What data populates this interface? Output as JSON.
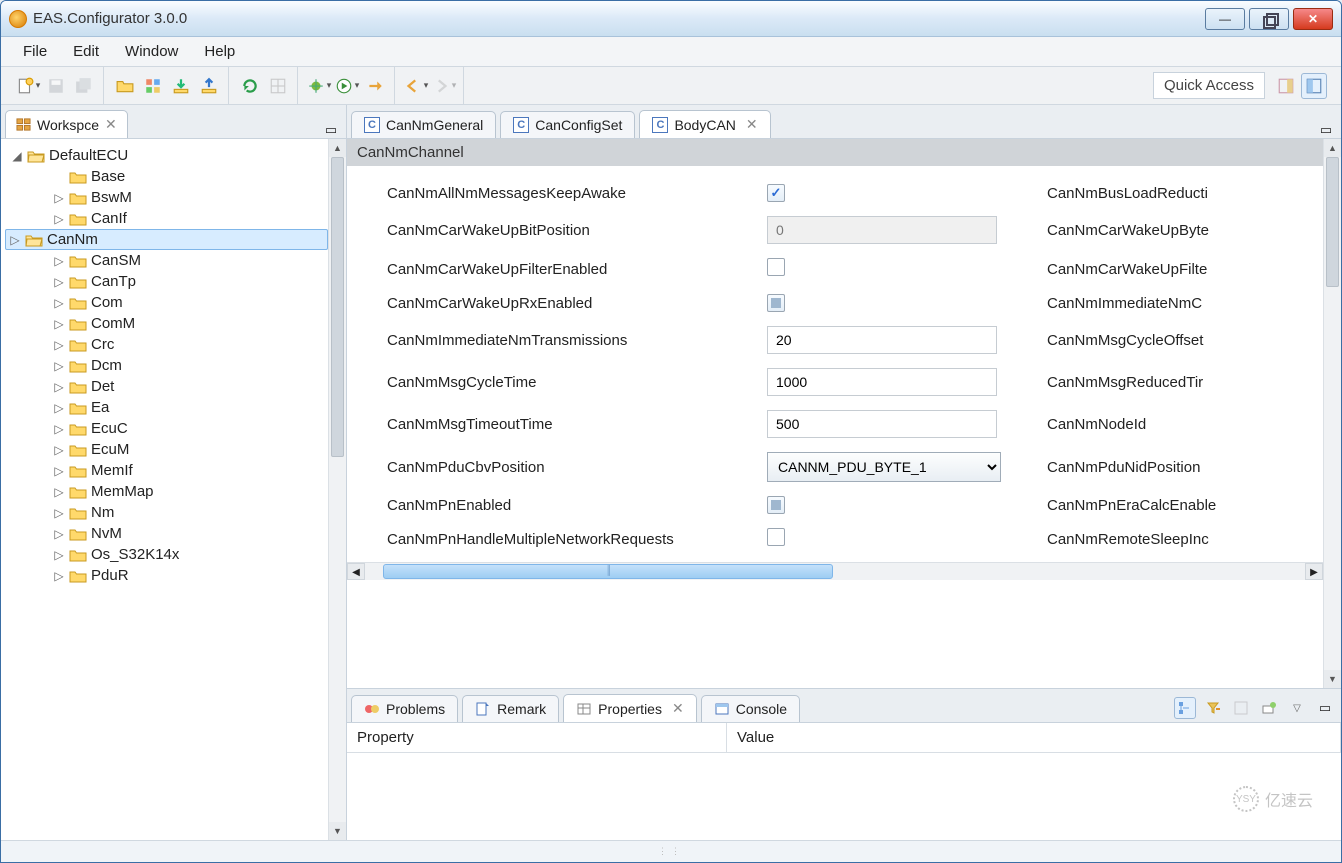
{
  "window": {
    "title": "EAS.Configurator 3.0.0",
    "quick_access": "Quick Access"
  },
  "menu": {
    "file": "File",
    "edit": "Edit",
    "window": "Window",
    "help": "Help"
  },
  "workspace": {
    "tab_label": "Workspce",
    "root": "DefaultECU",
    "items": [
      "Base",
      "BswM",
      "CanIf",
      "CanNm",
      "CanSM",
      "CanTp",
      "Com",
      "ComM",
      "Crc",
      "Dcm",
      "Det",
      "Ea",
      "EcuC",
      "EcuM",
      "MemIf",
      "MemMap",
      "Nm",
      "NvM",
      "Os_S32K14x",
      "PduR"
    ],
    "selected": "CanNm"
  },
  "editor": {
    "tabs": [
      {
        "label": "CanNmGeneral",
        "active": false
      },
      {
        "label": "CanConfigSet",
        "active": false
      },
      {
        "label": "BodyCAN",
        "active": true
      }
    ],
    "section": "CanNmChannel",
    "fields": [
      {
        "label": "CanNmAllNmMessagesKeepAwake",
        "type": "check",
        "state": "checked",
        "right": "CanNmBusLoadReducti"
      },
      {
        "label": "CanNmCarWakeUpBitPosition",
        "type": "text",
        "value": "0",
        "disabled": true,
        "right": "CanNmCarWakeUpByte"
      },
      {
        "label": "CanNmCarWakeUpFilterEnabled",
        "type": "check",
        "state": "",
        "right": "CanNmCarWakeUpFilte"
      },
      {
        "label": "CanNmCarWakeUpRxEnabled",
        "type": "check",
        "state": "tri",
        "right": "CanNmImmediateNmC"
      },
      {
        "label": "CanNmImmediateNmTransmissions",
        "type": "text",
        "value": "20",
        "right": "CanNmMsgCycleOffset"
      },
      {
        "label": "CanNmMsgCycleTime",
        "type": "text",
        "value": "1000",
        "right": "CanNmMsgReducedTir"
      },
      {
        "label": "CanNmMsgTimeoutTime",
        "type": "text",
        "value": "500",
        "right": "CanNmNodeId"
      },
      {
        "label": "CanNmPduCbvPosition",
        "type": "select",
        "value": "CANNM_PDU_BYTE_1",
        "right": "CanNmPduNidPosition"
      },
      {
        "label": "CanNmPnEnabled",
        "type": "check",
        "state": "tri",
        "right": "CanNmPnEraCalcEnable"
      },
      {
        "label": "CanNmPnHandleMultipleNetworkRequests",
        "type": "check",
        "state": "",
        "right": "CanNmRemoteSleepInc"
      }
    ]
  },
  "bottom": {
    "tabs": [
      "Problems",
      "Remark",
      "Properties",
      "Console"
    ],
    "active": "Properties",
    "columns": {
      "property": "Property",
      "value": "Value"
    }
  },
  "watermark": "亿速云",
  "icons": {
    "close_glyph": "✕",
    "min_glyph": "—"
  }
}
